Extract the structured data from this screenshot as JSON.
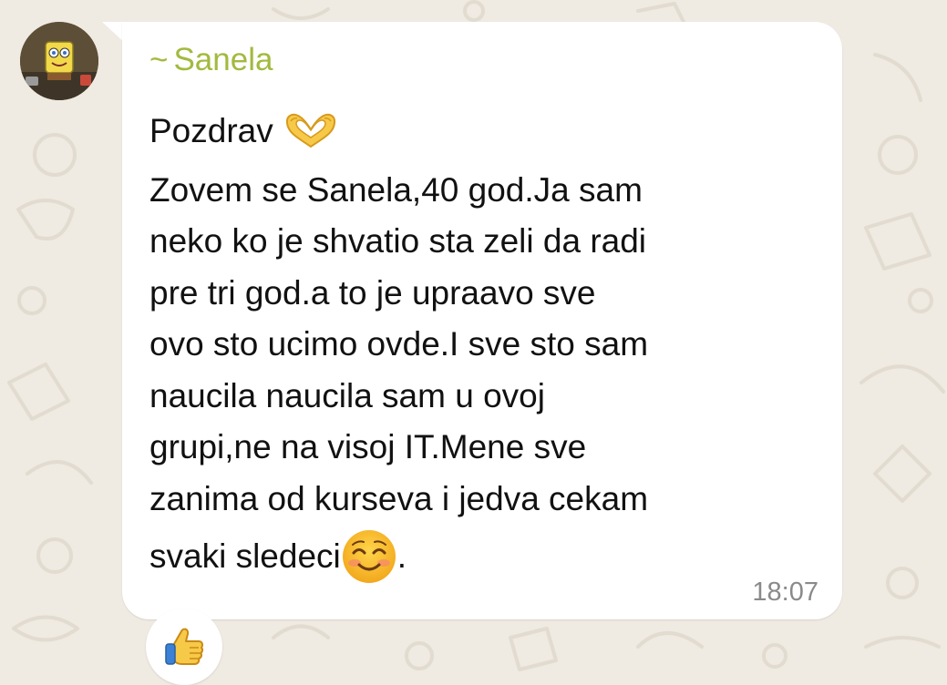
{
  "chat": {
    "sender": {
      "prefix": "~",
      "name": "Sanela",
      "name_color": "#a2ba3f",
      "avatar_icon": "spongebob-avatar"
    },
    "message": {
      "greeting_text": "Pozdrav",
      "greeting_emoji": "heart-hands-emoji",
      "lines": [
        "Zovem se Sanela,40 god.Ja sam",
        "neko ko je shvatio sta zeli da radi",
        "pre tri god.a to je upraavo sve",
        "ovo sto ucimo ovde.I sve sto sam",
        "naucila naucila sam u ovoj",
        "grupi,ne na visoj IT.Mene sve",
        "zanima od kurseva i jedva cekam"
      ],
      "last_line_before_emoji": "svaki sledeci",
      "last_line_emoji": "smiling-face-emoji",
      "last_line_after_emoji": ".",
      "timestamp": "18:07"
    },
    "reaction": {
      "emoji": "thumbs-up-emoji"
    }
  },
  "colors": {
    "wallpaper": "#efeae2",
    "bubble": "#ffffff",
    "text": "#111111",
    "timestamp": "#8a8a8a"
  }
}
